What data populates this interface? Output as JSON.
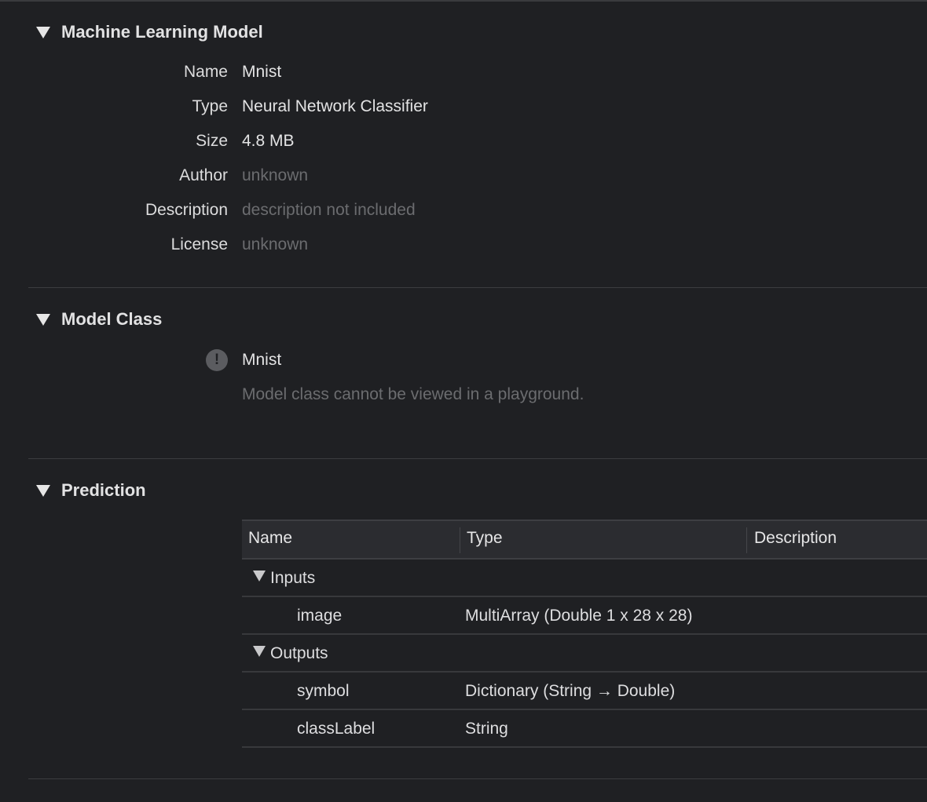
{
  "sections": {
    "ml_model": {
      "title": "Machine Learning Model",
      "rows": [
        {
          "label": "Name",
          "value": "Mnist"
        },
        {
          "label": "Type",
          "value": "Neural Network Classifier"
        },
        {
          "label": "Size",
          "value": "4.8 MB"
        },
        {
          "label": "Author",
          "value": "unknown"
        },
        {
          "label": "Description",
          "value": "description not included"
        },
        {
          "label": "License",
          "value": "unknown"
        }
      ]
    },
    "model_class": {
      "title": "Model Class",
      "icon": "exclamation-icon",
      "icon_glyph": "!",
      "class_name": "Mnist",
      "note": "Model class cannot be viewed in a playground."
    },
    "prediction": {
      "title": "Prediction",
      "columns": [
        "Name",
        "Type",
        "Description"
      ],
      "groups": [
        {
          "label": "Inputs",
          "rows": [
            {
              "name": "image",
              "type": "MultiArray (Double 1 x 28 x 28)",
              "description": ""
            }
          ]
        },
        {
          "label": "Outputs",
          "rows": [
            {
              "name": "symbol",
              "type": "Dictionary (String → Double)",
              "description": ""
            },
            {
              "name": "classLabel",
              "type": "String",
              "description": ""
            }
          ]
        }
      ]
    }
  }
}
